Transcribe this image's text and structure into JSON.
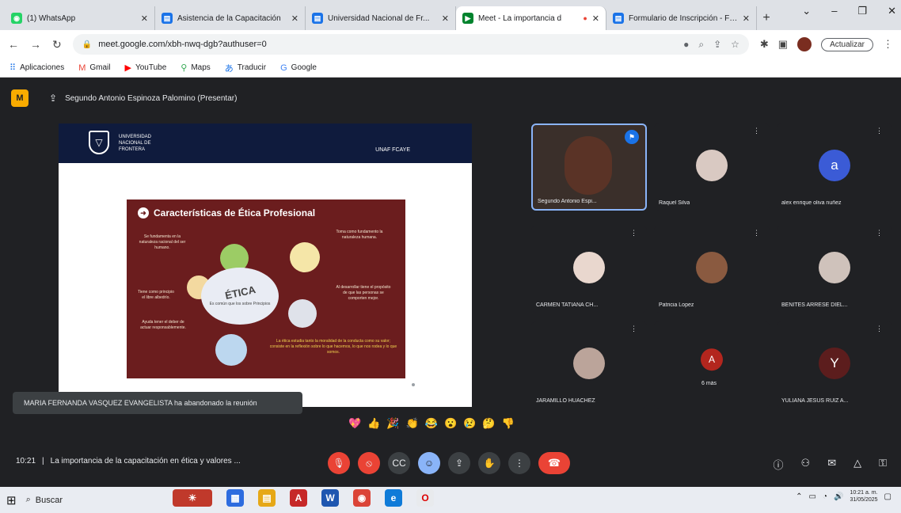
{
  "browser": {
    "tabs": [
      {
        "title": "(1) WhatsApp",
        "icon": "whatsapp-icon",
        "color": "#25d366"
      },
      {
        "title": "Asistencia de la Capacitación",
        "icon": "forms-icon",
        "color": "#1a73e8"
      },
      {
        "title": "Universidad Nacional de Fr...",
        "icon": "forms-icon",
        "color": "#1a73e8"
      },
      {
        "title": "Meet - La importancia d",
        "icon": "meet-icon",
        "color": "#00832d"
      },
      {
        "title": "Formulario de Inscripción - Form...",
        "icon": "forms-icon",
        "color": "#1a73e8"
      }
    ],
    "url": "meet.google.com/xbh-nwq-dgb?authuser=0",
    "update_label": "Actualizar"
  },
  "bookmarks": [
    {
      "label": "Aplicaciones",
      "icon": "apps-icon"
    },
    {
      "label": "Gmail",
      "icon": "gmail-icon"
    },
    {
      "label": "YouTube",
      "icon": "youtube-icon"
    },
    {
      "label": "Maps",
      "icon": "maps-icon"
    },
    {
      "label": "Traducir",
      "icon": "translate-icon"
    },
    {
      "label": "Google",
      "icon": "google-icon"
    }
  ],
  "meet": {
    "presenter": "Segundo Antonio Espinoza Palomino (Presentar)",
    "slide": {
      "uni_name": "UNIVERSIDAD NACIONAL DE FRONTERA",
      "header_right": "UNAF FCAYE",
      "title": "Características de Ética Profesional",
      "center_word": "ÉTICA",
      "center_sub": "Es común que los sobre Principios",
      "texts": [
        "Se fundamenta en la naturaleza racional del ser humano.",
        "Toma como fundamento la naturaleza humana.",
        "Tiene como principio el libre albedrío.",
        "Ayuda tener el deber de actuar responsablemente.",
        "Al desarrollar tiene el propósito de que las personas se comporten mejor."
      ],
      "highlight": "La ética estudia tanto la moralidad de la conducta como su valor; consiste en la reflexión sobre lo que hacemos, lo que nos rodea y lo que somos."
    },
    "notification": "MARIA FERNANDA VASQUEZ EVANGELISTA ha abandonado la reunión",
    "participants": [
      {
        "name": "Segundo Antonio Espi...",
        "type": "camera",
        "pinned": true
      },
      {
        "name": "Raquel Silva",
        "type": "photo",
        "avatar_color": "#d9c9c2"
      },
      {
        "name": "alex enrique oliva nuñez",
        "type": "letter",
        "letter": "a",
        "avatar_color": "#3b5bd6"
      },
      {
        "name": "CARMEN TATIANA CH...",
        "type": "photo",
        "avatar_color": "#e9d7ce"
      },
      {
        "name": "Patricia Lopez",
        "type": "photo",
        "avatar_color": "#8a5a40"
      },
      {
        "name": "BENITES ARRESE DIEL...",
        "type": "photo",
        "avatar_color": "#cfc2bb"
      },
      {
        "name": "JARAMILLO HUACHEZ",
        "type": "photo",
        "avatar_color": "#bba49a"
      },
      {
        "name": "6 más",
        "type": "letter",
        "letter": "A",
        "avatar_color": "#b3261e"
      },
      {
        "name": "YULIANA JESUS RUIZ A...",
        "type": "letter",
        "letter": "Y",
        "avatar_color": "#5c1d1d"
      }
    ],
    "reactions": [
      "💖",
      "👍",
      "🎉",
      "👏",
      "😂",
      "😮",
      "😢",
      "🤔",
      "👎"
    ],
    "time": "10:21",
    "meeting_title": "La importancia de la capacitación en ética y valores ..."
  },
  "taskbar": {
    "search_placeholder": "Buscar",
    "clock_time": "10:21 a. m.",
    "clock_date": "31/05/2025"
  }
}
